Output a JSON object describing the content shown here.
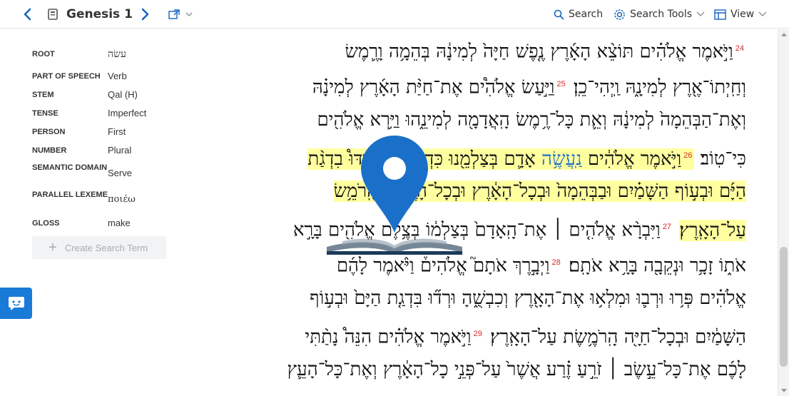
{
  "toolbar": {
    "back_icon": "chevron-left-icon",
    "book_icon": "book-icon",
    "reference": "Genesis 1",
    "forward_icon": "chevron-right-icon",
    "popout_icon": "popout-icon",
    "search_label": "Search",
    "search_tools_label": "Search Tools",
    "view_label": "View",
    "accent_color": "#1565c0"
  },
  "word_info": {
    "rows": [
      {
        "key": "ROOT",
        "value": "עשׂה"
      },
      {
        "key": "PART OF SPEECH",
        "value": "Verb"
      },
      {
        "key": "STEM",
        "value": "Qal (H)"
      },
      {
        "key": "TENSE",
        "value": "Imperfect"
      },
      {
        "key": "PERSON",
        "value": "First"
      },
      {
        "key": "NUMBER",
        "value": "Plural"
      },
      {
        "key": "SEMANTIC DOMAIN",
        "value": "Serve"
      },
      {
        "key": "PARALLEL LEXEME",
        "value": "ποιέω"
      },
      {
        "key": "GLOSS",
        "value": "make"
      }
    ],
    "create_search_label": "Create Search Term"
  },
  "chat_icon": "chat-icon",
  "scripture": {
    "lines": [
      {
        "verse_num": "24",
        "text_a": "וַיֹּ֣אמֶר אֱלֹהִ֗ים תּוֹצֵ֨א הָאָ֜רֶץ נֶ֤פֶשׁ חַיָּה֙ לְמִינָ֔הּ בְּהֵמָ֥ה וָרֶ֛מֶשׂ"
      },
      {
        "verse_num": "25",
        "text_a": "וְחַֽיְתוֹ־אֶ֖רֶץ לְמִינָ֑הּ וַֽיְהִי־כֵֽן׃",
        "text_b": "וַיַּ֣עַשׂ אֱלֹהִ֩ים אֶת־חַיַּ֨ת הָאָ֜רֶץ לְמִינָ֗הּ"
      },
      {
        "text_a": "וְאֶת־הַבְּהֵמָה֙ לְמִינָ֔הּ וְאֵ֛ת כָּל־רֶ֥מֶשׂ הָֽאֲדָמָ֖ה לְמִינֵ֑הוּ וַיַּ֥רְא אֱלֹהִ֖ים"
      },
      {
        "verse_num": "26",
        "text_a": "כִּי־טֽוֹב׃",
        "text_b": "וַיֹּ֣אמֶר אֱלֹהִ֔ים",
        "match": "נַֽעֲשֶׂ֥ה",
        "text_c": "אָדָ֛ם בְּצַלְמֵ֖נוּ כִּדְמוּתֵ֑נוּ וְיִרְדּוּ֩ בִדְגַ֨ת"
      },
      {
        "text_a": "הַיָּ֜ם וּבְע֣וֹף הַשָּׁמַ֗יִם וּבַבְּהֵמָה֙ וּבְכָל־הָאָ֔רֶץ וּבְכָל־הָרֶ֖מֶשׂ הָֽרֹמֵ֥שׂ"
      },
      {
        "verse_num": "27",
        "text_a": "עַל־הָאָֽרֶץ׃",
        "text_b": "וַיִּבְרָ֨א אֱלֹהִ֤ים ׀ אֶת־הָֽאָדָם֙ בְּצַלְמ֔וֹ בְּצֶ֥לֶם אֱלֹהִ֖ים בָּרָ֣א"
      },
      {
        "verse_num": "28",
        "text_a": "אֹת֑וֹ זָכָ֥ר וּנְקֵבָ֖ה בָּרָ֥א אֹתָֽם׃",
        "text_b": "וַיְבָ֣רֶךְ אֹתָם֮ אֱלֹהִים֒ וַיֹּ֨אמֶר לָהֶ֜ם"
      },
      {
        "text_a": "אֱלֹהִ֗ים פְּר֥וּ וּרְב֛וּ וּמִלְא֥וּ אֶת־הָאָ֖רֶץ וְכִבְשֻׁ֑הָ וּרְד֞וּ בִּדְגַ֤ת הַיָּם֙ וּבְע֣וֹף"
      },
      {
        "verse_num": "29",
        "text_a": "הַשָּׁמַ֔יִם וּבְכָל־חַיָּ֖ה הָֽרֹמֶ֥שֶׂת עַל־הָאָֽרֶץ׃",
        "text_b": "וַיֹּ֣אמֶר אֱלֹהִ֗ים הִנֵּה֩ נָתַ֨תִּי"
      },
      {
        "text_a": "לָכֶ֜ם אֶת־כָּל־עֵ֣שֶׂב ׀ זֹרֵ֣עַ זֶ֗רַע אֲשֶׁר֙ עַל־פְּנֵ֣י כָל־הָאָ֔רֶץ וְאֶת־כָּל־הָעֵ֛ץ"
      }
    ],
    "highlight_color": "#ffffa0",
    "match_color": "#1c6fc9",
    "verse_number_color": "#d92b2b"
  },
  "loading_logo": "map-pin-book-logo"
}
